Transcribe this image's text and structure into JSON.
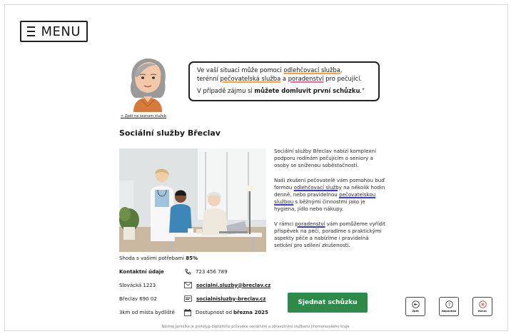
{
  "menu": {
    "label": "MENU"
  },
  "bubble": {
    "line1_pre": "Ve vaší situaci může pomoci ",
    "line1_link1": "odlehčovací služba",
    "line1_post": ",",
    "line2_pre": "terénní ",
    "line2_link2": "pečovatelská služba",
    "line2_mid": " a ",
    "line2_link3": "poradenství",
    "line2_post": " pro pečující.",
    "line3_pre": "V případě zájmu si ",
    "line3_bold": "můžete domluvit první schůzku",
    "line3_post": ".\""
  },
  "back_link": "< Zpět na seznam služeb",
  "title": "Sociální služby Břeclav",
  "description": {
    "p1": "Sociální služby Břeclav nabízí komplexní podporu rodinám pečujícím o seniory a osoby se sníženou soběstačností.",
    "p2_pre": "Naši zkušení pečovatelé vám pomohou buď formou ",
    "p2_link1": "odlehčovací služby",
    "p2_mid": " na několik hodin denně, nebo pravidelnou ",
    "p2_link2": "pečovatelskou službou",
    "p2_post": " s běžnými činnostmi jako je hygiena, jídlo nebo nákupy.",
    "p3_pre": "V rámci ",
    "p3_link": "poradenství",
    "p3_post": " vám pomůžeme vyřídit příspěvek na péči, poradíme s praktickými aspekty péče a nabízíme i pravidelná setkání pro sdílení zkušeností."
  },
  "match": {
    "label": "Shoda s vašimi potřebami ",
    "value": "85%"
  },
  "contact": {
    "heading": "Kontaktní údaje",
    "street": "Slovácká 1223",
    "city": "Břeclav 690 02",
    "distance": "3km od místa bydliště",
    "phone": "723 456 789",
    "email": "socialni.sluzby@breclav.cz",
    "web": "socialnisluzby-breclav.cz",
    "availability_pre": "Dostupnost od ",
    "availability_date": "března 2025"
  },
  "cta": {
    "label": "Sjednat schůzku"
  },
  "nav": {
    "back": "Zpět",
    "help": "Nápověda",
    "end": "Konec"
  },
  "footer": "Nástroj Jarmilka je prototyp digitálního průvodce sociálními a zdravotními službami Jihomoravského kraje",
  "colors": {
    "cta_green": "#2e8a48",
    "end_red": "#c0392b",
    "link_blue": "#3b3bd6",
    "ul_orange": "#f2a33a",
    "ul_purple": "#9b59d0",
    "ul_pink": "#e86aa3"
  }
}
